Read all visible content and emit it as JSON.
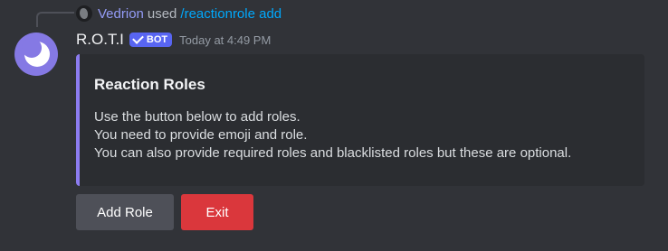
{
  "reply": {
    "username": "Vedrion",
    "action": "used",
    "command": "/reactionrole add"
  },
  "message": {
    "author": "R.O.T.I",
    "bot_tag": "BOT",
    "timestamp": "Today at 4:49 PM"
  },
  "embed": {
    "title": "Reaction Roles",
    "lines": [
      "Use the button below to add roles.",
      "You need to provide emoji and role.",
      "You can also provide required roles and blacklisted roles but these are optional."
    ],
    "accent_color": "#8c7cf0"
  },
  "buttons": {
    "add_role": "Add Role",
    "exit": "Exit"
  },
  "colors": {
    "background": "#313338",
    "bot_tag": "#5865f2",
    "danger": "#da373c",
    "secondary": "#4e5058",
    "command_link": "#00a8fc"
  }
}
